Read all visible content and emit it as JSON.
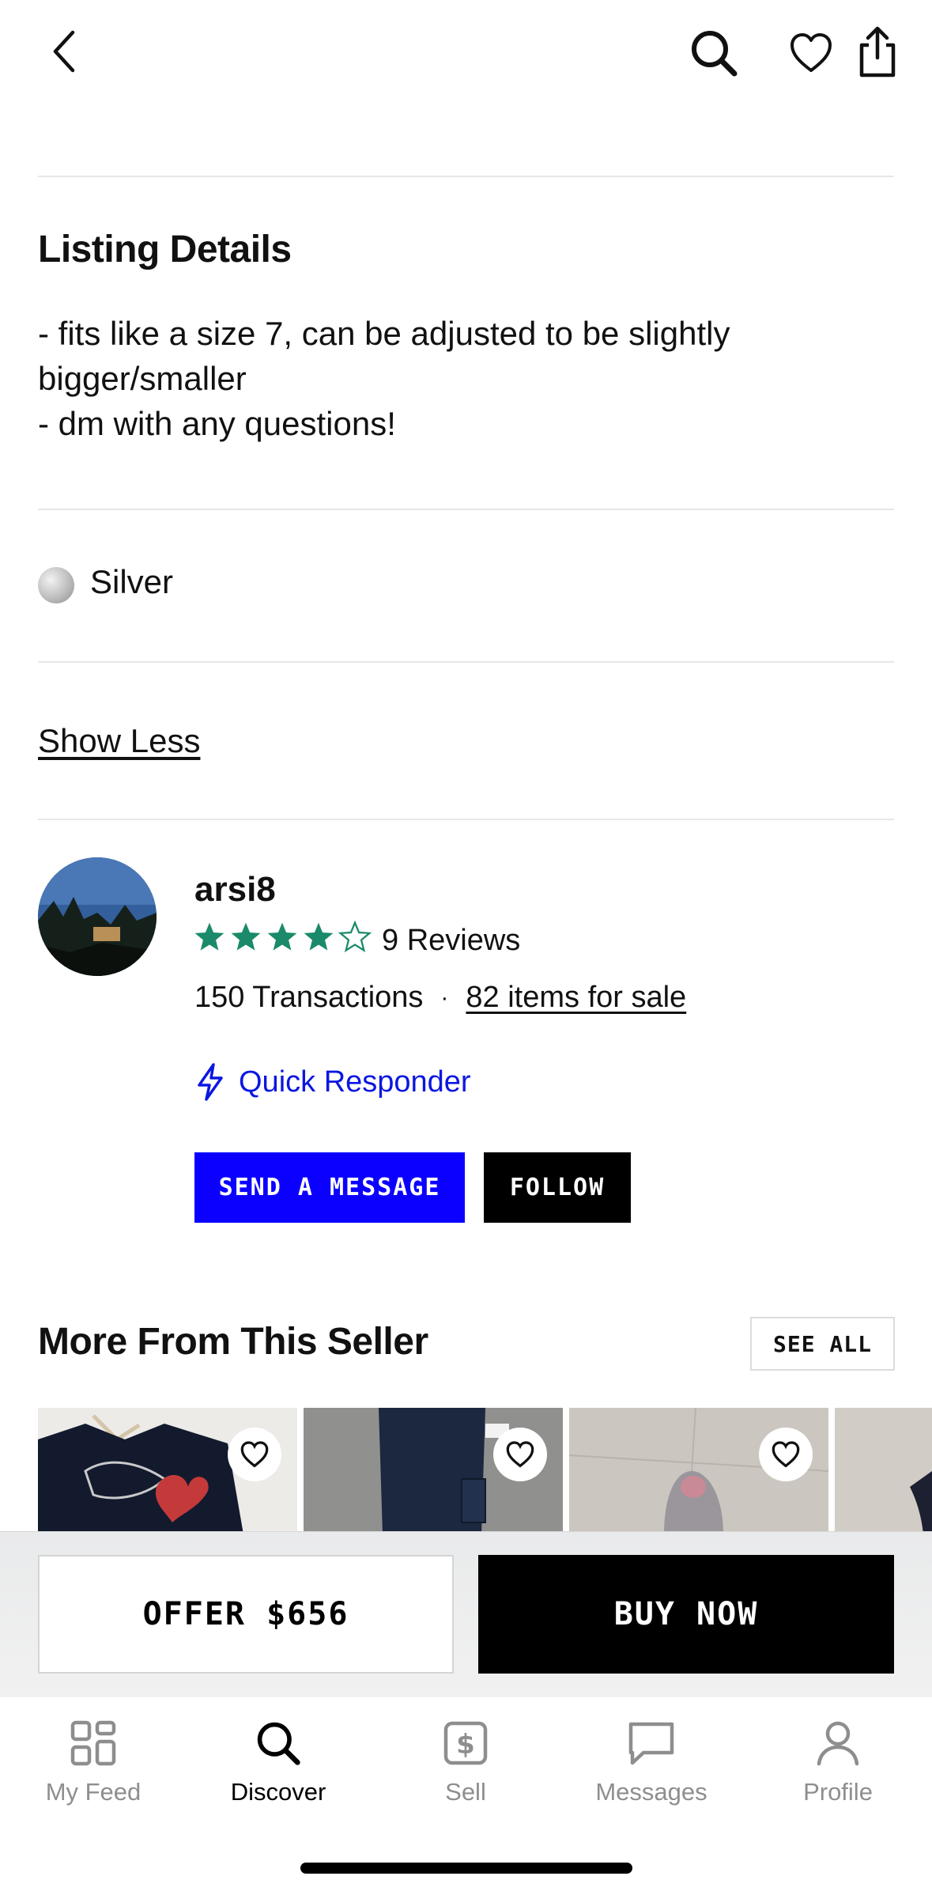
{
  "listing": {
    "title": "Listing Details",
    "description": [
      "- fits like a size 7, can be adjusted to be slightly bigger/smaller",
      "- dm with any questions!"
    ],
    "color": "Silver",
    "show_less": "Show Less"
  },
  "seller": {
    "username": "arsi8",
    "rating": 4,
    "rating_max": 5,
    "reviews": "9 Reviews",
    "transactions": "150 Transactions",
    "separator": "·",
    "items_for_sale": "82 items for sale",
    "quick_responder": "Quick Responder",
    "send_message": "SEND A MESSAGE",
    "follow": "FOLLOW"
  },
  "more_from_seller": {
    "title": "More From This Seller",
    "see_all": "SEE ALL"
  },
  "actions": {
    "offer": "OFFER $656",
    "buy_now": "BUY NOW"
  },
  "tabs": [
    {
      "label": "My Feed",
      "icon": "grid-icon",
      "active": false
    },
    {
      "label": "Discover",
      "icon": "search-icon",
      "active": true
    },
    {
      "label": "Sell",
      "icon": "dollar-tag-icon",
      "active": false
    },
    {
      "label": "Messages",
      "icon": "chat-bubble-icon",
      "active": false
    },
    {
      "label": "Profile",
      "icon": "person-icon",
      "active": false
    }
  ],
  "colors": {
    "star": "#1a8a6a",
    "accent_blue": "#0b00ff",
    "link_blue": "#0b17e0",
    "text": "#111111",
    "inactive_tab": "#8e8e8e"
  }
}
